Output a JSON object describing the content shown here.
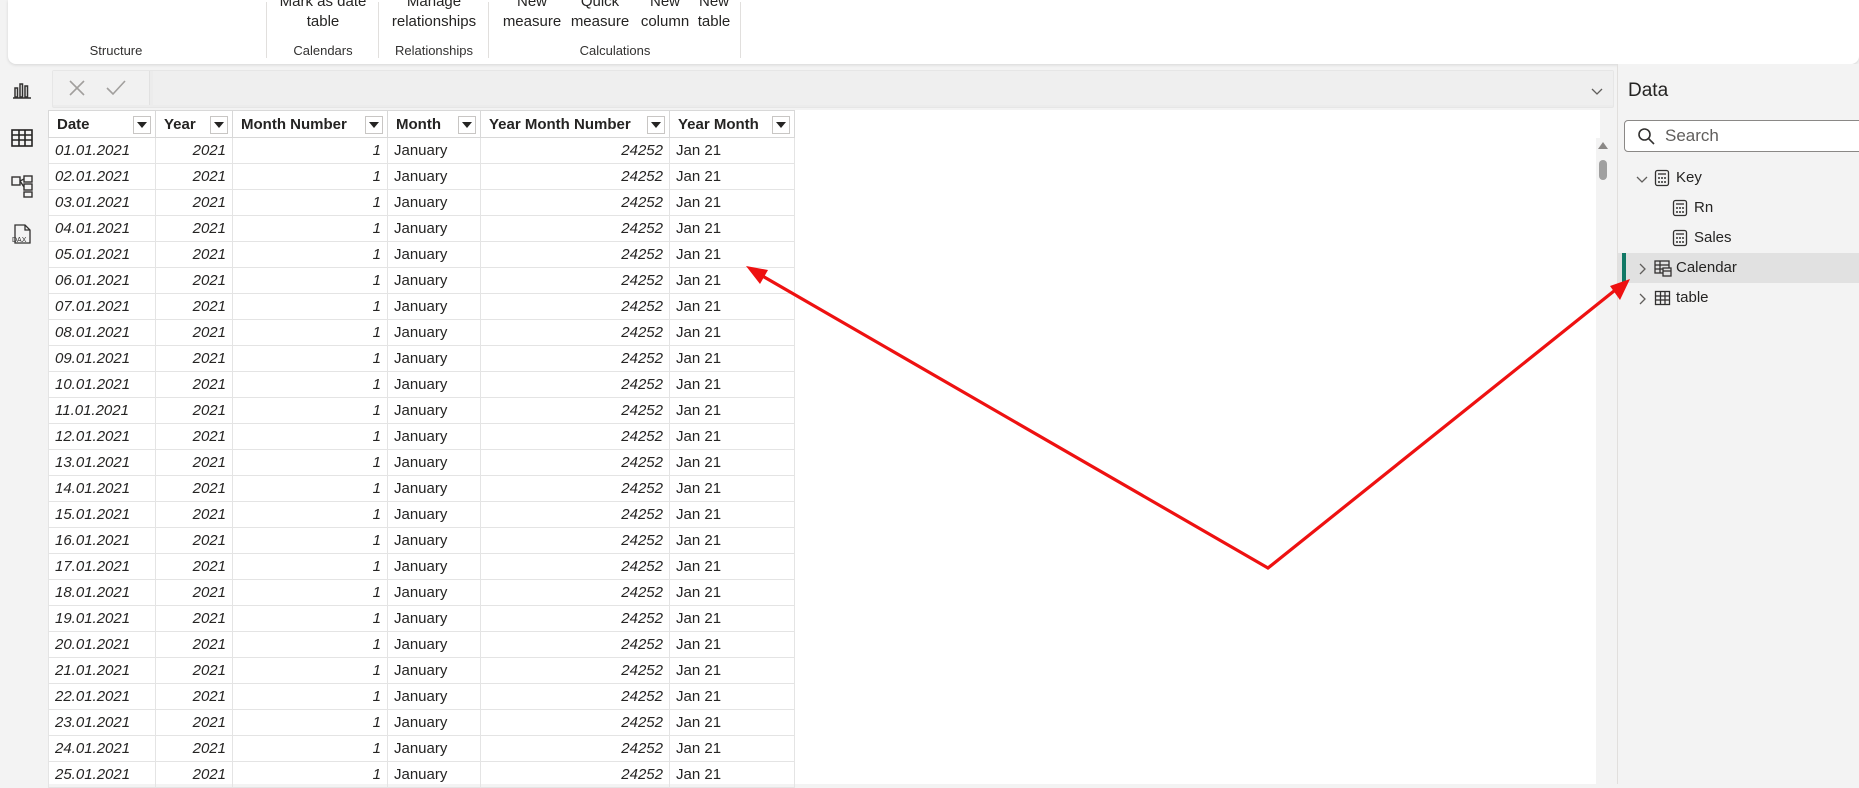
{
  "ribbon": {
    "groups": [
      {
        "name": "Structure"
      },
      {
        "name": "Calendars",
        "buttons": [
          {
            "label": "Mark as date\ntable"
          }
        ]
      },
      {
        "name": "Relationships",
        "buttons": [
          {
            "label": "Manage\nrelationships"
          }
        ]
      },
      {
        "name": "Calculations",
        "buttons": [
          {
            "label": "New\nmeasure"
          },
          {
            "label": "Quick\nmeasure"
          },
          {
            "label": "New\ncolumn"
          },
          {
            "label": "New\ntable"
          }
        ]
      }
    ]
  },
  "leftnav": {
    "icons": [
      "report-view-icon",
      "table-view-icon",
      "model-view-icon",
      "dax-query-view-icon"
    ]
  },
  "table": {
    "columns": [
      "Date",
      "Year",
      "Month Number",
      "Month",
      "Year Month Number",
      "Year Month"
    ],
    "rows": [
      [
        "01.01.2021",
        "2021",
        "1",
        "January",
        "24252",
        "Jan 21"
      ],
      [
        "02.01.2021",
        "2021",
        "1",
        "January",
        "24252",
        "Jan 21"
      ],
      [
        "03.01.2021",
        "2021",
        "1",
        "January",
        "24252",
        "Jan 21"
      ],
      [
        "04.01.2021",
        "2021",
        "1",
        "January",
        "24252",
        "Jan 21"
      ],
      [
        "05.01.2021",
        "2021",
        "1",
        "January",
        "24252",
        "Jan 21"
      ],
      [
        "06.01.2021",
        "2021",
        "1",
        "January",
        "24252",
        "Jan 21"
      ],
      [
        "07.01.2021",
        "2021",
        "1",
        "January",
        "24252",
        "Jan 21"
      ],
      [
        "08.01.2021",
        "2021",
        "1",
        "January",
        "24252",
        "Jan 21"
      ],
      [
        "09.01.2021",
        "2021",
        "1",
        "January",
        "24252",
        "Jan 21"
      ],
      [
        "10.01.2021",
        "2021",
        "1",
        "January",
        "24252",
        "Jan 21"
      ],
      [
        "11.01.2021",
        "2021",
        "1",
        "January",
        "24252",
        "Jan 21"
      ],
      [
        "12.01.2021",
        "2021",
        "1",
        "January",
        "24252",
        "Jan 21"
      ],
      [
        "13.01.2021",
        "2021",
        "1",
        "January",
        "24252",
        "Jan 21"
      ],
      [
        "14.01.2021",
        "2021",
        "1",
        "January",
        "24252",
        "Jan 21"
      ],
      [
        "15.01.2021",
        "2021",
        "1",
        "January",
        "24252",
        "Jan 21"
      ],
      [
        "16.01.2021",
        "2021",
        "1",
        "January",
        "24252",
        "Jan 21"
      ],
      [
        "17.01.2021",
        "2021",
        "1",
        "January",
        "24252",
        "Jan 21"
      ],
      [
        "18.01.2021",
        "2021",
        "1",
        "January",
        "24252",
        "Jan 21"
      ],
      [
        "19.01.2021",
        "2021",
        "1",
        "January",
        "24252",
        "Jan 21"
      ],
      [
        "20.01.2021",
        "2021",
        "1",
        "January",
        "24252",
        "Jan 21"
      ],
      [
        "21.01.2021",
        "2021",
        "1",
        "January",
        "24252",
        "Jan 21"
      ],
      [
        "22.01.2021",
        "2021",
        "1",
        "January",
        "24252",
        "Jan 21"
      ],
      [
        "23.01.2021",
        "2021",
        "1",
        "January",
        "24252",
        "Jan 21"
      ],
      [
        "24.01.2021",
        "2021",
        "1",
        "January",
        "24252",
        "Jan 21"
      ],
      [
        "25.01.2021",
        "2021",
        "1",
        "January",
        "24252",
        "Jan 21"
      ]
    ]
  },
  "data_pane": {
    "title": "Data",
    "search_placeholder": "Search",
    "tree": [
      {
        "label": "Key",
        "expanded": true,
        "icon": "calculator-table-icon"
      },
      {
        "label": "Rn",
        "icon": "measure-icon"
      },
      {
        "label": "Sales",
        "icon": "measure-icon"
      },
      {
        "label": "Calendar",
        "expanded": false,
        "selected": true,
        "icon": "calendar-table-icon"
      },
      {
        "label": "table",
        "expanded": false,
        "icon": "table-icon"
      }
    ]
  },
  "colors": {
    "annotation_arrow": "#ee1111",
    "selected_accent": "#117865"
  }
}
